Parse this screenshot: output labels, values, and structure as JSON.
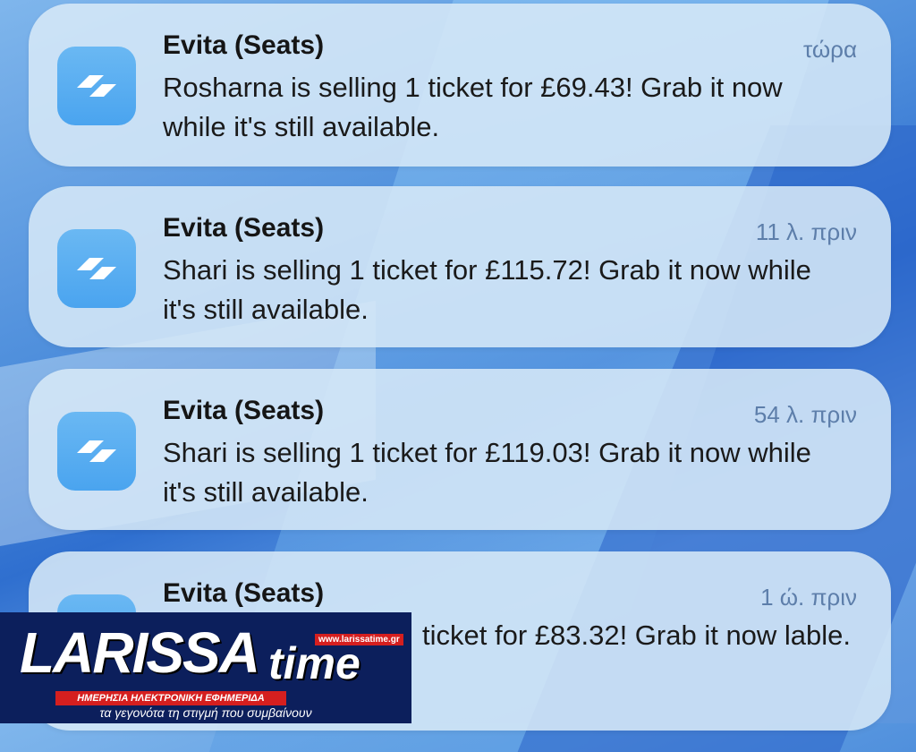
{
  "notifications": [
    {
      "app_name": "Evita (Seats)",
      "time": "τώρα",
      "message": "Rosharna is selling 1 ticket for £69.43! Grab it now while it's still available.",
      "icon": "app-logo-icon"
    },
    {
      "app_name": "Evita (Seats)",
      "time": "11 λ. πριν",
      "message": "Shari is selling 1 ticket for £115.72! Grab it now while it's still available.",
      "icon": "app-logo-icon"
    },
    {
      "app_name": "Evita (Seats)",
      "time": "54 λ. πριν",
      "message": "Shari is selling 1 ticket for £119.03! Grab it now while it's still available.",
      "icon": "app-logo-icon"
    },
    {
      "app_name": "Evita (Seats)",
      "time": "1 ώ. πριν",
      "message": "ticket for £83.32! Grab it now lable.",
      "icon": "app-logo-icon"
    }
  ],
  "watermark": {
    "word_main": "LARISSA",
    "word_time": "time",
    "url": "www.larissatime.gr",
    "strip": "ΗΜΕΡΗΣΙΑ ΗΛΕΚΤΡΟΝΙΚΗ ΕΦΗΜΕΡΙΔΑ",
    "tagline": "τα γεγονότα τη στιγμή που συμβαίνουν"
  },
  "colors": {
    "icon_bg": "#4aa4ef",
    "card_bg": "#d6e8f7",
    "time_text": "#5d7eaa",
    "watermark_bg": "#0c1f5c",
    "watermark_red": "#d51f1f"
  }
}
